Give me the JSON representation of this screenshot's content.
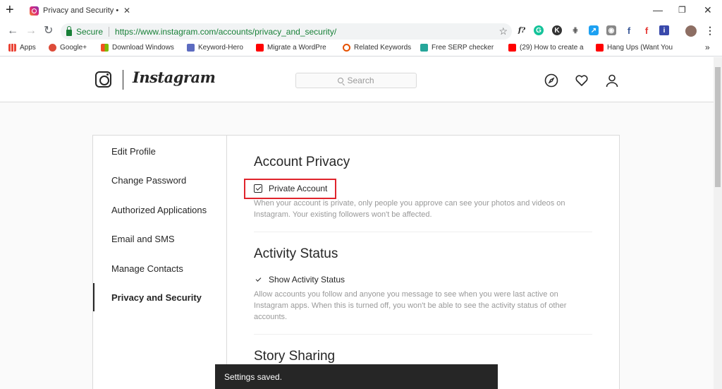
{
  "browser": {
    "tab_title": "Privacy and Security • Ins",
    "omnibox": {
      "secure_label": "Secure",
      "url": "https://www.instagram.com/accounts/privacy_and_security/"
    },
    "bookmarks": [
      {
        "label": "Apps",
        "color": "#4285f4"
      },
      {
        "label": "Google+",
        "color": "#dd4b39"
      },
      {
        "label": "Download Windows",
        "color": "#f25022"
      },
      {
        "label": "Keyword-Hero",
        "color": "#5c6bc0"
      },
      {
        "label": "Migrate a WordPre",
        "color": "#ff0000"
      },
      {
        "label": "Related Keywords",
        "color": "#e65100"
      },
      {
        "label": "Free SERP checker",
        "color": "#26a69a"
      },
      {
        "label": "(29) How to create a",
        "color": "#ff0000"
      },
      {
        "label": "Hang Ups (Want You",
        "color": "#ff0000"
      }
    ],
    "more_bookmarks": "»"
  },
  "ig": {
    "brand": "Instagram",
    "search_placeholder": "Search",
    "sidebar": [
      {
        "label": "Edit Profile"
      },
      {
        "label": "Change Password"
      },
      {
        "label": "Authorized Applications"
      },
      {
        "label": "Email and SMS"
      },
      {
        "label": "Manage Contacts"
      },
      {
        "label": "Privacy and Security",
        "active": true
      }
    ],
    "sections": {
      "account_privacy": {
        "title": "Account Privacy",
        "option": "Private Account",
        "checked": true,
        "desc": "When your account is private, only people you approve can see your photos and videos on Instagram. Your existing followers won't be affected."
      },
      "activity_status": {
        "title": "Activity Status",
        "option": "Show Activity Status",
        "checked": true,
        "desc": "Allow accounts you follow and anyone you message to see when you were last active on Instagram apps. When this is turned off, you won't be able to see the activity status of other accounts."
      },
      "story_sharing": {
        "title": "Story Sharing"
      }
    },
    "toast": "Settings saved."
  },
  "colors": {
    "highlight": "#e0242c",
    "secure_green": "#188038"
  }
}
